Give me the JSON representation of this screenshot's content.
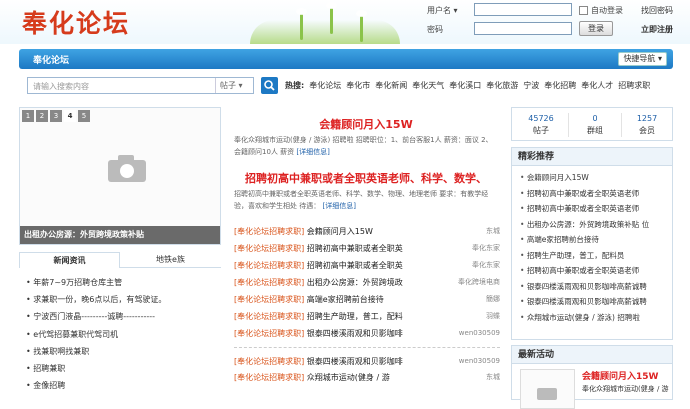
{
  "header": {
    "logo": "奉化论坛",
    "username_label": "用户名",
    "username_dropdown": "▾",
    "password_label": "密码",
    "auto_login": "自动登录",
    "find_password": "找回密码",
    "login_button": "登录",
    "register": "立即注册"
  },
  "nav": {
    "title": "奉化论坛",
    "quick_nav": "快捷导航"
  },
  "search": {
    "placeholder": "请输入搜索内容",
    "type": "帖子"
  },
  "hot": {
    "label": "热搜:",
    "items": [
      "奉化论坛",
      "奉化市",
      "奉化新闻",
      "奉化天气",
      "奉化溪口",
      "奉化旅游",
      "宁波",
      "奉化招聘",
      "奉化人才",
      "招聘求职"
    ]
  },
  "slider": {
    "pages": [
      "1",
      "2",
      "3",
      "4",
      "5"
    ],
    "current": "4",
    "caption": "出租办公房源：外贸跨境政策补贴"
  },
  "left_tabs": [
    "新闻资讯",
    "地铁e族"
  ],
  "left_list": [
    "年薪7~9万招聘仓库主管",
    "求兼职一份，晚6点以后，有驾驶证。",
    "宁波西门液晶---------诚聘-----------",
    "e代驾招募兼职代驾司机",
    "找兼职啊找兼职",
    "招聘兼职",
    "金像招聘"
  ],
  "center": {
    "headline1": "会籍顾问月入15W",
    "desc1": "奉化众翔城市运动(健身 / 游泳) 招聘啦 招聘职位：1、前台客服1人 薪资：面议 2、会籍顾问10人 薪资",
    "detail1": "[详细信息]",
    "headline2": "招聘初高中兼职或者全职英语老师、科学、数学、",
    "desc2": "招聘初高中兼职或者全职英语老师、科学、数学、物理、地理老师 要求：有教学经验，喜欢和学生相处 待遇：",
    "detail2": "[详细信息]",
    "rows": [
      {
        "tag": "[奉化论坛招聘求职]",
        "title": "会籍顾问月入15W",
        "author": "东城"
      },
      {
        "tag": "[奉化论坛招聘求职]",
        "title": "招聘初高中兼职或者全职英",
        "author": "奉化东家"
      },
      {
        "tag": "[奉化论坛招聘求职]",
        "title": "招聘初高中兼职或者全职英",
        "author": "奉化东家"
      },
      {
        "tag": "[奉化论坛招聘求职]",
        "title": "出租办公房源：外贸跨境政",
        "author": "奉化跨境电商"
      },
      {
        "tag": "[奉化论坛招聘求职]",
        "title": "高端e家招聘前台接待",
        "author": "簡娜"
      },
      {
        "tag": "[奉化论坛招聘求职]",
        "title": "招聘生产助理，普工，配料",
        "author": "羽蝶"
      },
      {
        "tag": "[奉化论坛招聘求职]",
        "title": "银泰四楼溪雨观和贝影咖啡",
        "author": "wen030509"
      },
      {
        "tag": "[奉化论坛招聘求职]",
        "title": "银泰四楼溪雨观和贝影咖啡",
        "author": "wen030509"
      },
      {
        "tag": "[奉化论坛招聘求职]",
        "title": "众翔城市运动(健身 / 游",
        "author": "东城"
      }
    ]
  },
  "stats": [
    {
      "num": "45726",
      "label": "帖子"
    },
    {
      "num": "0",
      "label": "群组"
    },
    {
      "num": "1257",
      "label": "会员"
    }
  ],
  "recommend": {
    "title": "精彩推荐",
    "items": [
      "会籍顾问月入15W",
      "招聘初高中兼职或者全职英语老师",
      "招聘初高中兼职或者全职英语老师",
      "出租办公房源：外贸跨境政策补贴 位",
      "高端e家招聘前台接待",
      "招聘生产助理，普工，配料员",
      "招聘初高中兼职或者全职英语老师",
      "银泰四楼溪雨观和贝影咖啡高薪诚聘",
      "银泰四楼溪雨观和贝影咖啡高薪诚聘",
      "众翔城市运动(健身 / 游泳) 招聘啦"
    ]
  },
  "activity": {
    "title": "最新活动",
    "item_title": "会籍顾问月入15W",
    "item_sub": "奉化众翔城市运动(健身 / 游"
  }
}
